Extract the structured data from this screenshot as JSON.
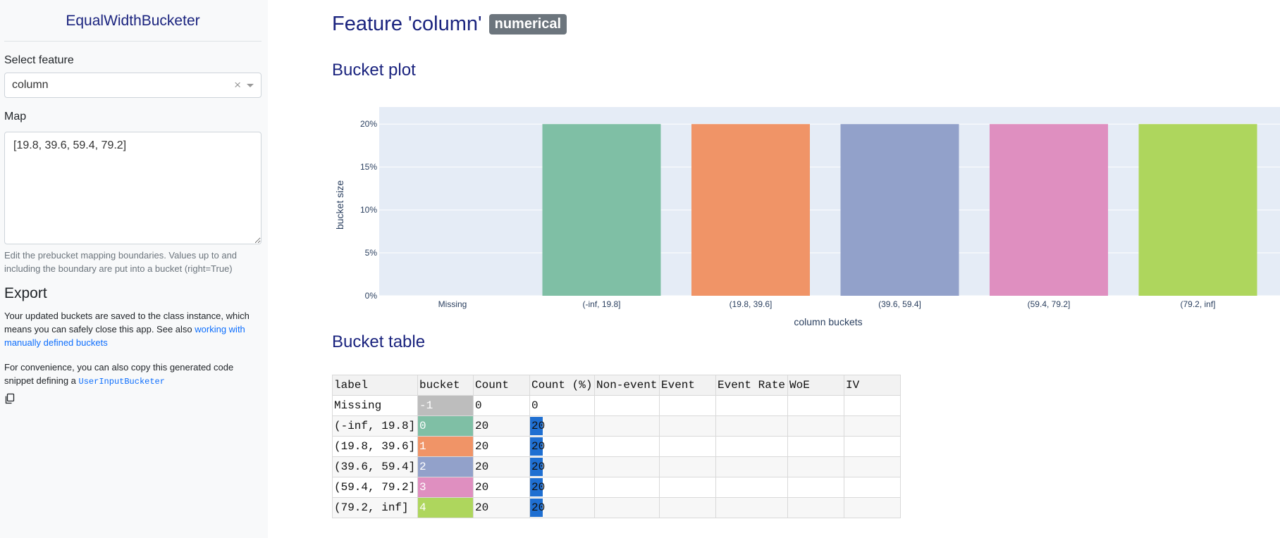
{
  "sidebar": {
    "title": "EqualWidthBucketer",
    "select_label": "Select feature",
    "select_value": "column",
    "map_label": "Map",
    "map_value": "[19.8, 39.6, 59.4, 79.2]",
    "help_text": "Edit the prebucket mapping boundaries. Values up to and including the boundary are put into a bucket (right=True)",
    "export_heading": "Export",
    "export_p1_text": "Your updated buckets are saved to the class instance, which means you can safely close this app. See also ",
    "export_p1_link": "working with manually defined buckets",
    "export_p2_text": "For convenience, you can also copy this generated code snippet defining a ",
    "export_p2_code": "UserInputBucketer",
    "copy_icon": "copy-icon"
  },
  "main": {
    "title": "Feature 'column'",
    "badge": "numerical",
    "plot_heading": "Bucket plot",
    "table_heading": "Bucket table"
  },
  "chart_data": {
    "type": "bar",
    "categories": [
      "Missing",
      "(-inf, 19.8]",
      "(19.8, 39.6]",
      "(39.6, 59.4]",
      "(59.4, 79.2]",
      "(79.2, inf]"
    ],
    "values": [
      0,
      0.2,
      0.2,
      0.2,
      0.2,
      0.2
    ],
    "colors": [
      "#bdbdbd",
      "#7fbfa5",
      "#f09467",
      "#92a1ca",
      "#df8fc0",
      "#aed65d"
    ],
    "xlabel": "column buckets",
    "ylabel": "bucket size",
    "ylim": [
      0,
      0.21
    ],
    "yticks": [
      "0%",
      "5%",
      "10%",
      "15%",
      "20%"
    ],
    "ytick_values": [
      0,
      0.05,
      0.1,
      0.15,
      0.2
    ],
    "grid": true,
    "background": "#e5ecf6"
  },
  "table": {
    "headers": [
      "label",
      "bucket",
      "Count",
      "Count (%)",
      "Non-event",
      "Event",
      "Event Rate",
      "WoE",
      "IV"
    ],
    "rows": [
      {
        "label": "Missing",
        "bucket": "-1",
        "count": "0",
        "pct": "0",
        "pct_fill": 0,
        "color": "#bdbdbd"
      },
      {
        "label": "(-inf, 19.8]",
        "bucket": "0",
        "count": "20",
        "pct": "20",
        "pct_fill": 0.2,
        "color": "#7fbfa5"
      },
      {
        "label": "(19.8, 39.6]",
        "bucket": "1",
        "count": "20",
        "pct": "20",
        "pct_fill": 0.2,
        "color": "#f09467"
      },
      {
        "label": "(39.6, 59.4]",
        "bucket": "2",
        "count": "20",
        "pct": "20",
        "pct_fill": 0.2,
        "color": "#92a1ca"
      },
      {
        "label": "(59.4, 79.2]",
        "bucket": "3",
        "count": "20",
        "pct": "20",
        "pct_fill": 0.2,
        "color": "#df8fc0"
      },
      {
        "label": "(79.2, inf]",
        "bucket": "4",
        "count": "20",
        "pct": "20",
        "pct_fill": 0.2,
        "color": "#aed65d"
      }
    ]
  }
}
